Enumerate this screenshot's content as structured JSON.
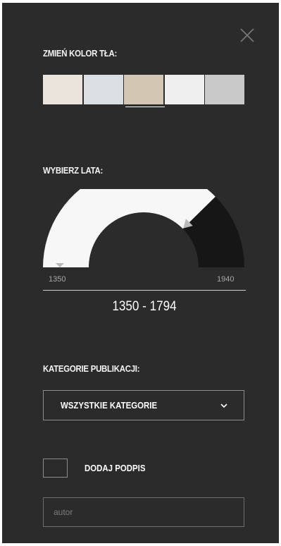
{
  "panel": {
    "close_icon": "close-icon"
  },
  "background_color": {
    "label": "ZMIEŃ KOLOR TŁA:",
    "swatches": [
      {
        "name": "swatch-1",
        "color": "#ebe4dd"
      },
      {
        "name": "swatch-2",
        "color": "#d9dfe2"
      },
      {
        "name": "swatch-3",
        "color": "#d1c7b2",
        "selected": true
      },
      {
        "name": "swatch-4",
        "color": "#efefef"
      },
      {
        "name": "swatch-5",
        "color": "#c9c9c9"
      }
    ]
  },
  "years": {
    "label": "WYBIERZ LATA:",
    "min": 1350,
    "max": 1940,
    "min_label": "1350",
    "max_label": "1940",
    "selected_start": 1350,
    "selected_end": 1794,
    "selected_range_text": "1350 - 1794"
  },
  "categories": {
    "label": "KATEGORIE PUBLIKACJI:",
    "selected": "WSZYSTKIE KATEGORIE",
    "chevron_icon": "chevron-down-icon"
  },
  "signature": {
    "label": "DODAJ PODPIS",
    "checked": false
  },
  "author": {
    "placeholder": "autor",
    "value": ""
  }
}
